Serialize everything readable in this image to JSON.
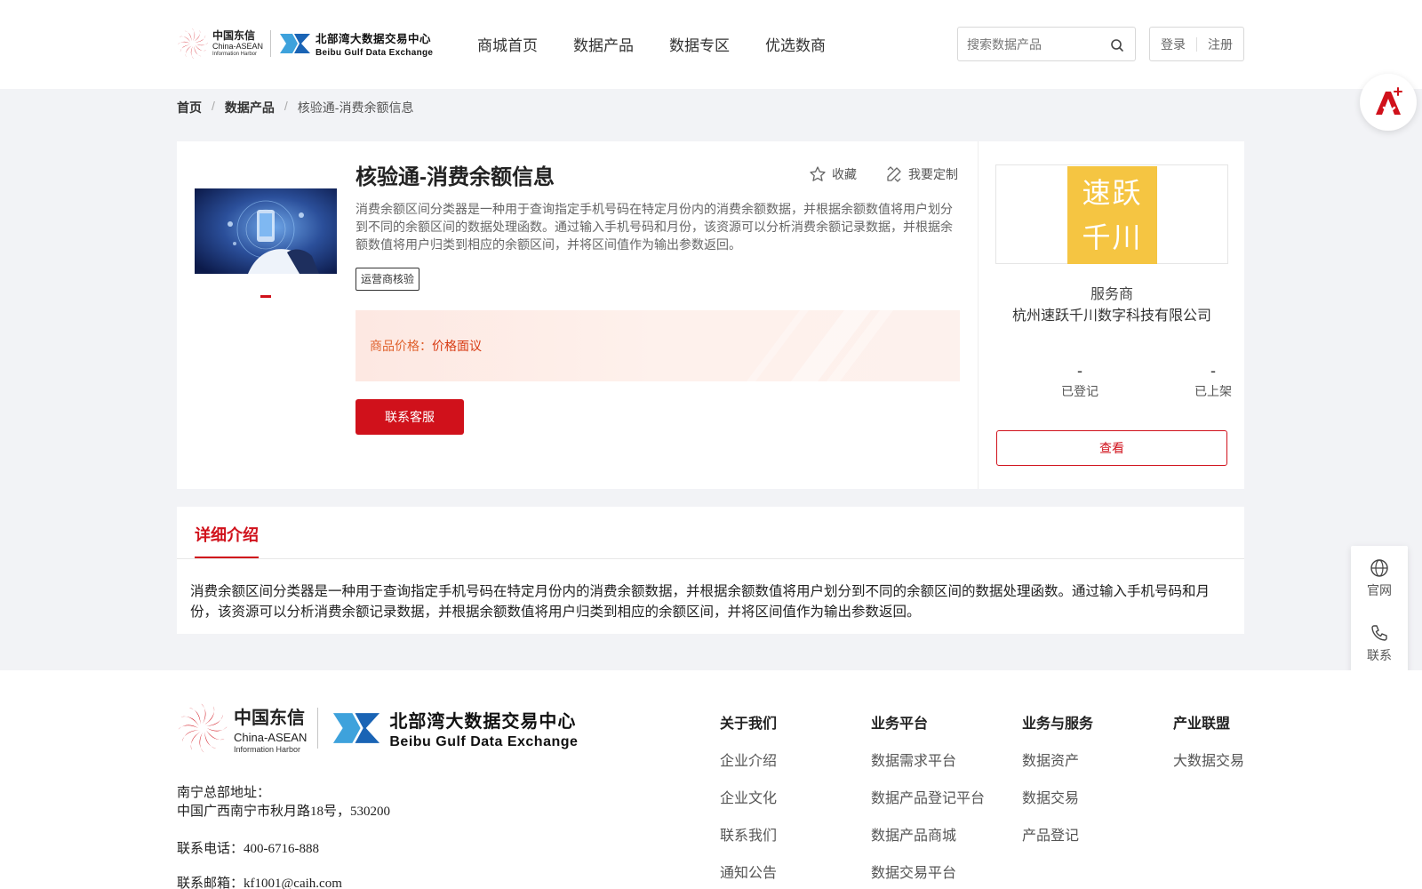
{
  "header": {
    "logo_cn": {
      "line1": "中国东信",
      "line2": "China-ASEAN",
      "line3": "Information Harbor"
    },
    "logo_bb": {
      "line1": "北部湾大数据交易中心",
      "line2": "Beibu Gulf Data Exchange"
    },
    "nav": [
      "商城首页",
      "数据产品",
      "数据专区",
      "优选数商"
    ],
    "search_placeholder": "搜索数据产品",
    "login": "登录",
    "register": "注册"
  },
  "breadcrumb": [
    "首页",
    "数据产品",
    "核验通-消费余额信息"
  ],
  "product": {
    "title": "核验通-消费余额信息",
    "favorite": "收藏",
    "customize": "我要定制",
    "description": "消费余额区间分类器是一种用于查询指定手机号码在特定月份内的消费余额数据，并根据余额数值将用户划分到不同的余额区间的数据处理函数。通过输入手机号码和月份，该资源可以分析消费余额记录数据，并根据余额数值将用户归类到相应的余额区间，并将区间值作为输出参数返回。",
    "tag": "运营商核验",
    "price_label": "商品价格：",
    "price_value": "价格面议",
    "contact_button": "联系客服"
  },
  "vendor": {
    "logo_line1": "速跃",
    "logo_line2": "千川",
    "role": "服务商",
    "name": "杭州速跃千川数字科技有限公司",
    "stats": [
      {
        "value": "-",
        "label": "已登记"
      },
      {
        "value": "-",
        "label": "已上架"
      }
    ],
    "view_button": "查看"
  },
  "detail": {
    "tab": "详细介绍",
    "text": "消费余额区间分类器是一种用于查询指定手机号码在特定月份内的消费余额数据，并根据余额数值将用户划分到不同的余额区间的数据处理函数。通过输入手机号码和月份，该资源可以分析消费余额记录数据，并根据余额数值将用户归类到相应的余额区间，并将区间值作为输出参数返回。"
  },
  "sidebar": {
    "official": "官网",
    "contact": "联系"
  },
  "footer": {
    "address_label": "南宁总部地址：",
    "address": "中国广西南宁市秋月路18号，530200",
    "phone": "联系电话：400-6716-888",
    "email": "联系邮箱：kf1001@caih.com",
    "columns": [
      {
        "title": "关于我们",
        "items": [
          "企业介绍",
          "企业文化",
          "联系我们",
          "通知公告"
        ]
      },
      {
        "title": "业务平台",
        "items": [
          "数据需求平台",
          "数据产品登记平台",
          "数据产品商城",
          "数据交易平台"
        ]
      },
      {
        "title": "业务与服务",
        "items": [
          "数据资产",
          "数据交易",
          "产品登记"
        ]
      },
      {
        "title": "产业联盟",
        "items": [
          "大数据交易"
        ]
      }
    ]
  },
  "colors": {
    "brand_red": "#d0111b",
    "vendor_logo_bg": "#f5c542",
    "price_text": "#d83a12",
    "page_bg": "#f2f3f6"
  }
}
